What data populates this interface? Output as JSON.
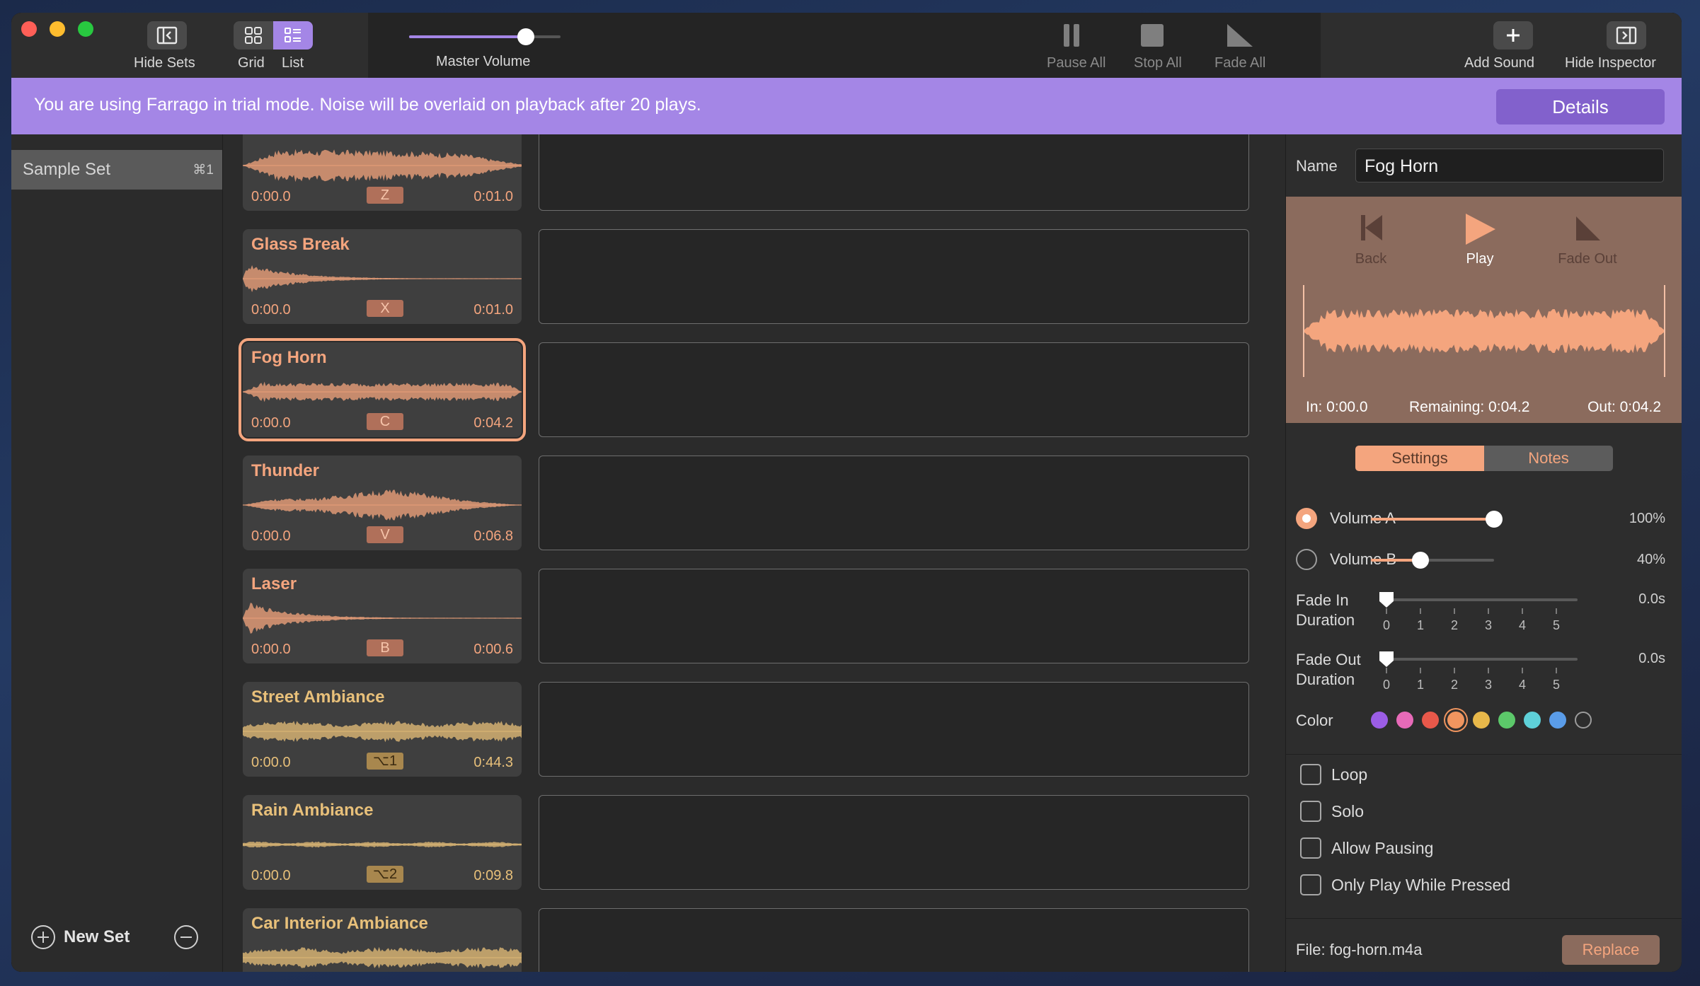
{
  "toolbar": {
    "hide_sets": "Hide Sets",
    "grid": "Grid",
    "list": "List",
    "master_volume": "Master Volume",
    "master_volume_level": 0.77,
    "pause_all": "Pause All",
    "stop_all": "Stop All",
    "fade_all": "Fade All",
    "add_sound": "Add Sound",
    "hide_inspector": "Hide Inspector"
  },
  "trial": {
    "message": "You are using Farrago in trial mode. Noise will be overlaid on playback after 20 plays.",
    "details": "Details"
  },
  "sidebar": {
    "sets": [
      {
        "name": "Sample Set",
        "shortcut": "⌘1"
      }
    ],
    "new_set": "New Set"
  },
  "tiles": [
    {
      "name": "",
      "in": "0:00.0",
      "key": "Z",
      "out": "0:01.0",
      "color": "#f4a57e",
      "wave": "dense"
    },
    {
      "name": "Glass Break",
      "in": "0:00.0",
      "key": "X",
      "out": "0:01.0",
      "color": "#f4a57e",
      "wave": "burst"
    },
    {
      "name": "Fog Horn",
      "in": "0:00.0",
      "key": "C",
      "out": "0:04.2",
      "color": "#f4a57e",
      "wave": "sustained",
      "selected": true
    },
    {
      "name": "Thunder",
      "in": "0:00.0",
      "key": "V",
      "out": "0:06.8",
      "color": "#f4a57e",
      "wave": "thunder"
    },
    {
      "name": "Laser",
      "in": "0:00.0",
      "key": "B",
      "out": "0:00.6",
      "color": "#f4a57e",
      "wave": "burst"
    },
    {
      "name": "Street Ambiance",
      "in": "0:00.0",
      "key": "⌥1",
      "out": "0:44.3",
      "color": "#e8c07a",
      "wave": "ambient"
    },
    {
      "name": "Rain Ambiance",
      "in": "0:00.0",
      "key": "⌥2",
      "out": "0:09.8",
      "color": "#e8c07a",
      "wave": "flat"
    },
    {
      "name": "Car Interior Ambiance",
      "in": "",
      "key": "",
      "out": "",
      "color": "#e8c07a",
      "wave": "ambient"
    }
  ],
  "inspector": {
    "name_label": "Name",
    "name_value": "Fog Horn",
    "back": "Back",
    "play": "Play",
    "fade_out": "Fade Out",
    "in_time": "In: 0:00.0",
    "remaining": "Remaining: 0:04.2",
    "out_time": "Out: 0:04.2",
    "tab_settings": "Settings",
    "tab_notes": "Notes",
    "volume_a_label": "Volume A",
    "volume_a_value": "100%",
    "volume_a_level": 1.0,
    "volume_b_label": "Volume B",
    "volume_b_value": "40%",
    "volume_b_level": 0.4,
    "fade_in_label_1": "Fade In",
    "fade_in_label_2": "Duration",
    "fade_in_value": "0.0s",
    "fade_out_label_1": "Fade Out",
    "fade_out_label_2": "Duration",
    "fade_out_value": "0.0s",
    "ticks": [
      "0",
      "1",
      "2",
      "3",
      "4",
      "5"
    ],
    "color_label": "Color",
    "colors": [
      "#9b5de5",
      "#e76ab8",
      "#e8584a",
      "#f0955f",
      "#e8b84a",
      "#5cc86a",
      "#5ed0d8",
      "#5a9ce8",
      "none"
    ],
    "selected_color": 3,
    "loop": "Loop",
    "solo": "Solo",
    "allow_pausing": "Allow Pausing",
    "only_play_while_pressed": "Only Play While Pressed",
    "file": "File: fog-horn.m4a",
    "replace": "Replace"
  }
}
